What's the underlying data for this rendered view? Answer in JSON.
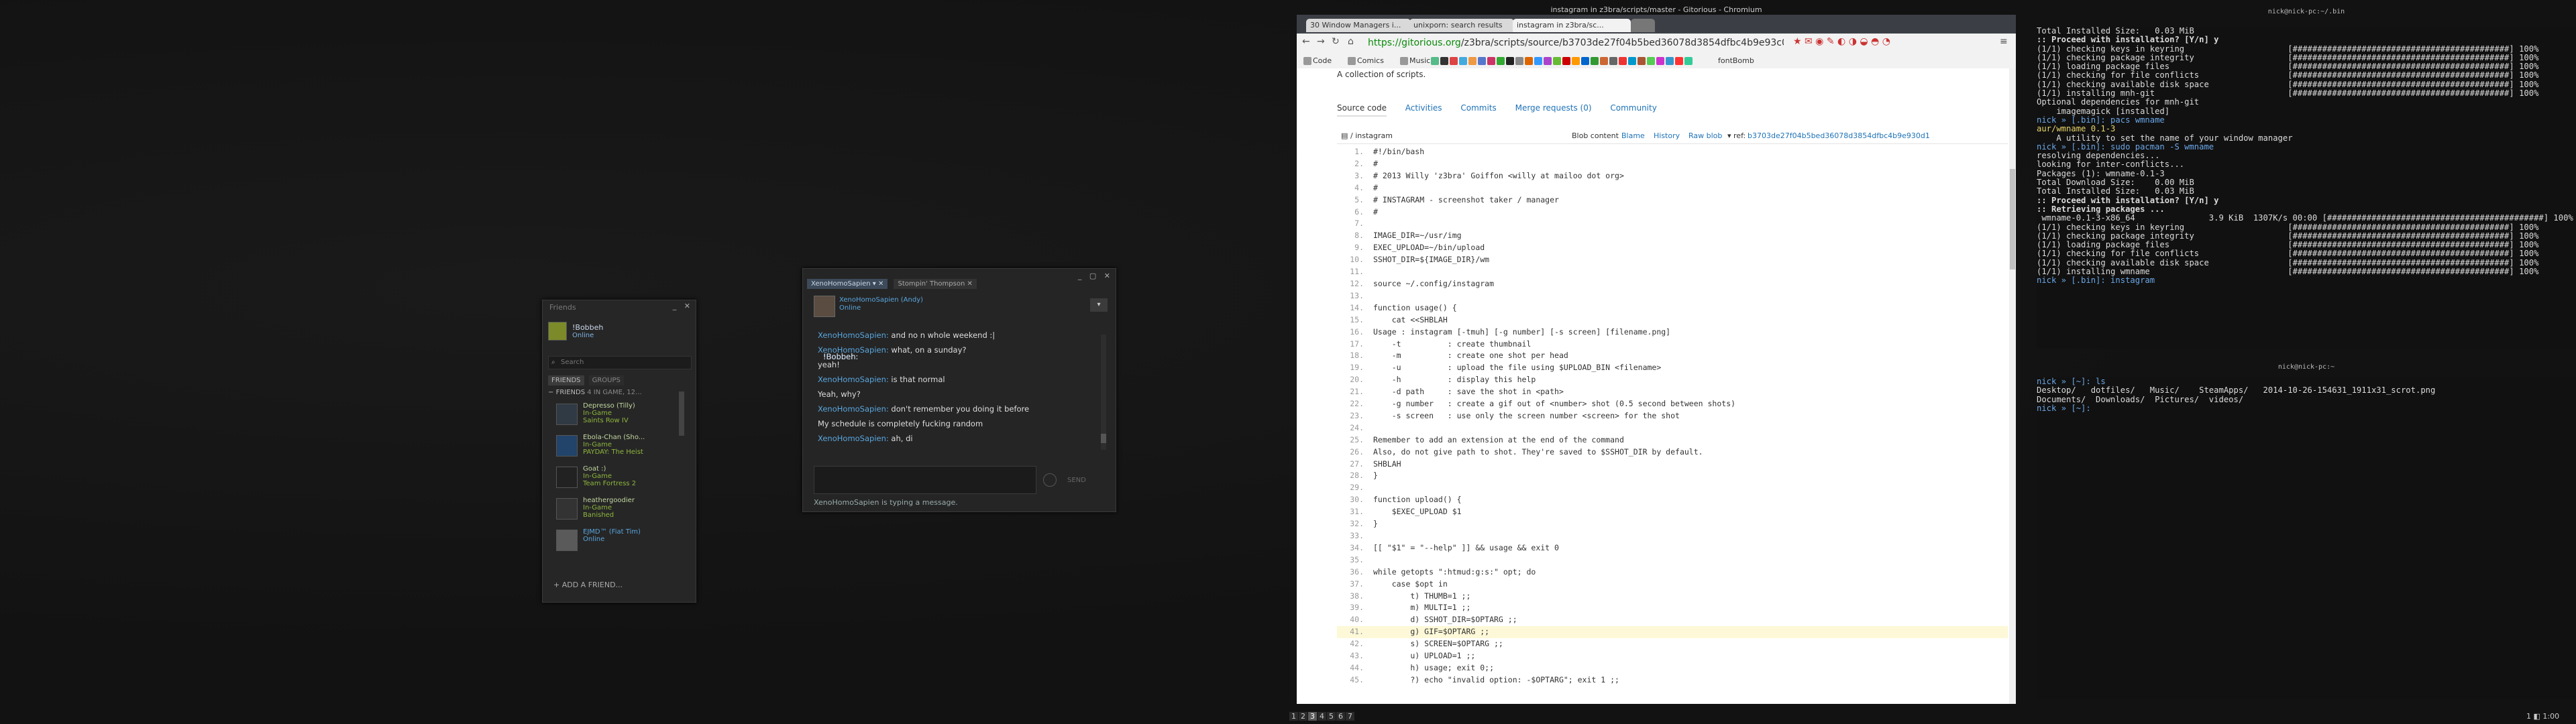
{
  "friends": {
    "title": "Friends",
    "me_name": "!Bobbeh",
    "me_status": "Online",
    "search_placeholder": "Search",
    "tab_friends": "FRIENDS",
    "tab_groups": "GROUPS",
    "section": "FRIENDS",
    "section_count": "4 IN GAME, 12...",
    "list": [
      {
        "name": "Depresso (Tilly)",
        "s1": "In-Game",
        "s2": "Saints Row IV"
      },
      {
        "name": "Ebola-Chan (Sho...",
        "s1": "In-Game",
        "s2": "PAYDAY: The Heist"
      },
      {
        "name": "Goat :)",
        "s1": "In-Game",
        "s2": "Team Fortress 2"
      },
      {
        "name": "heathergoodier",
        "s1": "In-Game",
        "s2": "Banished"
      },
      {
        "name": "EJMD™ (Fiat Tim)",
        "s1": "Online",
        "s2": ""
      }
    ],
    "add_friend": "ADD A FRIEND..."
  },
  "chat": {
    "tab1": "XenoHomoSapien",
    "tab2": "Stompin' Thompson",
    "contact_name": "XenoHomoSapien (Andy)",
    "contact_status": "Online",
    "messages": [
      {
        "user": "XenoHomoSapien:",
        "text": "and no n whole weekend :|"
      },
      {
        "user": "XenoHomoSapien:",
        "text": "what, on a sunday?"
      },
      {
        "user": "!Bobbeh:",
        "text": "yeah!"
      },
      {
        "user": "XenoHomoSapien:",
        "text": "is that normal"
      },
      {
        "user": "!Bobbeh:",
        "text": "Yeah, why?"
      },
      {
        "user": "XenoHomoSapien:",
        "text": "don't remember you doing it before"
      },
      {
        "user": "!Bobbeh:",
        "text": "My schedule is completely fucking random"
      },
      {
        "user": "XenoHomoSapien:",
        "text": "ah, di"
      }
    ],
    "send": "SEND",
    "typing": "XenoHomoSapien is typing a message."
  },
  "browser": {
    "window_title": "instagram in z3bra/scripts/master - Gitorious - Chromium",
    "tabs": [
      "30 Window Managers i...",
      "unixporn: search results",
      "instagram in z3bra/sc..."
    ],
    "url_host": "https://gitorious.org",
    "url_path": "/z3bra/scripts/source/b3703de27f04b5bed36078d3854dfbc4b9e93c0",
    "bookmarks": [
      "Code",
      "Comics",
      "Music",
      "fontBomb"
    ],
    "collection": "A collection of scripts.",
    "page_tabs": [
      "Source code",
      "Activities",
      "Commits",
      "Merge requests (0)",
      "Community"
    ],
    "file_path": "/ instagram",
    "blob": "Blob content",
    "blame": "Blame",
    "history": "History",
    "raw": "Raw blob",
    "ref_label": "ref:",
    "ref": "b3703de27f04b5bed36078d3854dfbc4b9e930d1",
    "code": [
      "#!/bin/bash",
      "#",
      "# 2013 Willy 'z3bra' Goiffon <willy at mailoo dot org>",
      "#",
      "# INSTAGRAM - screenshot taker / manager",
      "#",
      "",
      "IMAGE_DIR=~/usr/img",
      "EXEC_UPLOAD=~/bin/upload",
      "SSHOT_DIR=${IMAGE_DIR}/wm",
      "",
      "source ~/.config/instagram",
      "",
      "function usage() {",
      "    cat <<SHBLAH",
      "Usage : instagram [-tmuh] [-g number] [-s screen] [filename.png]",
      "    -t          : create thumbnail",
      "    -m          : create one shot per head",
      "    -u          : upload the file using $UPLOAD_BIN <filename>",
      "    -h          : display this help",
      "    -d path     : save the shot in <path>",
      "    -g number   : create a gif out of <number> shot (0.5 second between shots)",
      "    -s screen   : use only the screen number <screen> for the shot",
      "",
      "Remember to add an extension at the end of the command",
      "Also, do not give path to shot. They're saved to $SSHOT_DIR by default.",
      "SHBLAH",
      "}",
      "",
      "function upload() {",
      "    $EXEC_UPLOAD $1",
      "}",
      "",
      "[[ \"$1\" = \"--help\" ]] && usage && exit 0",
      "",
      "while getopts \":htmud:g:s:\" opt; do",
      "    case $opt in",
      "        t) THUMB=1 ;;",
      "        m) MULTI=1 ;;",
      "        d) SSHOT_DIR=$OPTARG ;;",
      "        g) GIF=$OPTARG ;;",
      "        s) SCREEN=$OPTARG ;;",
      "        u) UPLOAD=1 ;;",
      "        h) usage; exit 0;;",
      "        ?) echo \"invalid option: -$OPTARG\"; exit 1 ;;"
    ],
    "highlight_line": 41
  },
  "pager": [
    "1",
    "2",
    "3",
    "4",
    "5",
    "6",
    "7"
  ],
  "term1": {
    "title": "nick@nick-pc:~/.bin",
    "lines": [
      "Total Installed Size:   0.03 MiB",
      "",
      ":: Proceed with installation? [Y/n] y",
      "(1/1) checking keys in keyring                     [############################################] 100%",
      "(1/1) checking package integrity                   [############################################] 100%",
      "(1/1) loading package files                        [############################################] 100%",
      "(1/1) checking for file conflicts                  [############################################] 100%",
      "(1/1) checking available disk space                [############################################] 100%",
      "(1/1) installing mnh-git                           [############################################] 100%",
      "Optional dependencies for mnh-git",
      "    imagemagick [installed]",
      "nick » [.bin]: pacs wmname",
      "aur/wmname 0.1-3",
      "    A utility to set the name of your window manager",
      "nick » [.bin]: sudo pacman -S wmname",
      "resolving dependencies...",
      "looking for inter-conflicts...",
      "",
      "Packages (1): wmname-0.1-3",
      "",
      "Total Download Size:    0.00 MiB",
      "Total Installed Size:   0.03 MiB",
      "",
      ":: Proceed with installation? [Y/n] y",
      ":: Retrieving packages ...",
      " wmname-0.1-3-x86_64               3.9 KiB  1307K/s 00:00 [############################################] 100%",
      "(1/1) checking keys in keyring                     [############################################] 100%",
      "(1/1) checking package integrity                   [############################################] 100%",
      "(1/1) loading package files                        [############################################] 100%",
      "(1/1) checking for file conflicts                  [############################################] 100%",
      "(1/1) checking available disk space                [############################################] 100%",
      "(1/1) installing wmname                            [############################################] 100%",
      "nick » [.bin]: instagram"
    ]
  },
  "term2": {
    "title": "nick@nick-pc:~",
    "lines": [
      "nick » [~]: ls",
      "Desktop/   dotfiles/   Music/    SteamApps/   2014-10-26-154631_1911x31_scrot.png",
      "Documents/  Downloads/  Pictures/  videos/",
      "nick » [~]: "
    ]
  },
  "tray": "1 ◧ 1:00"
}
